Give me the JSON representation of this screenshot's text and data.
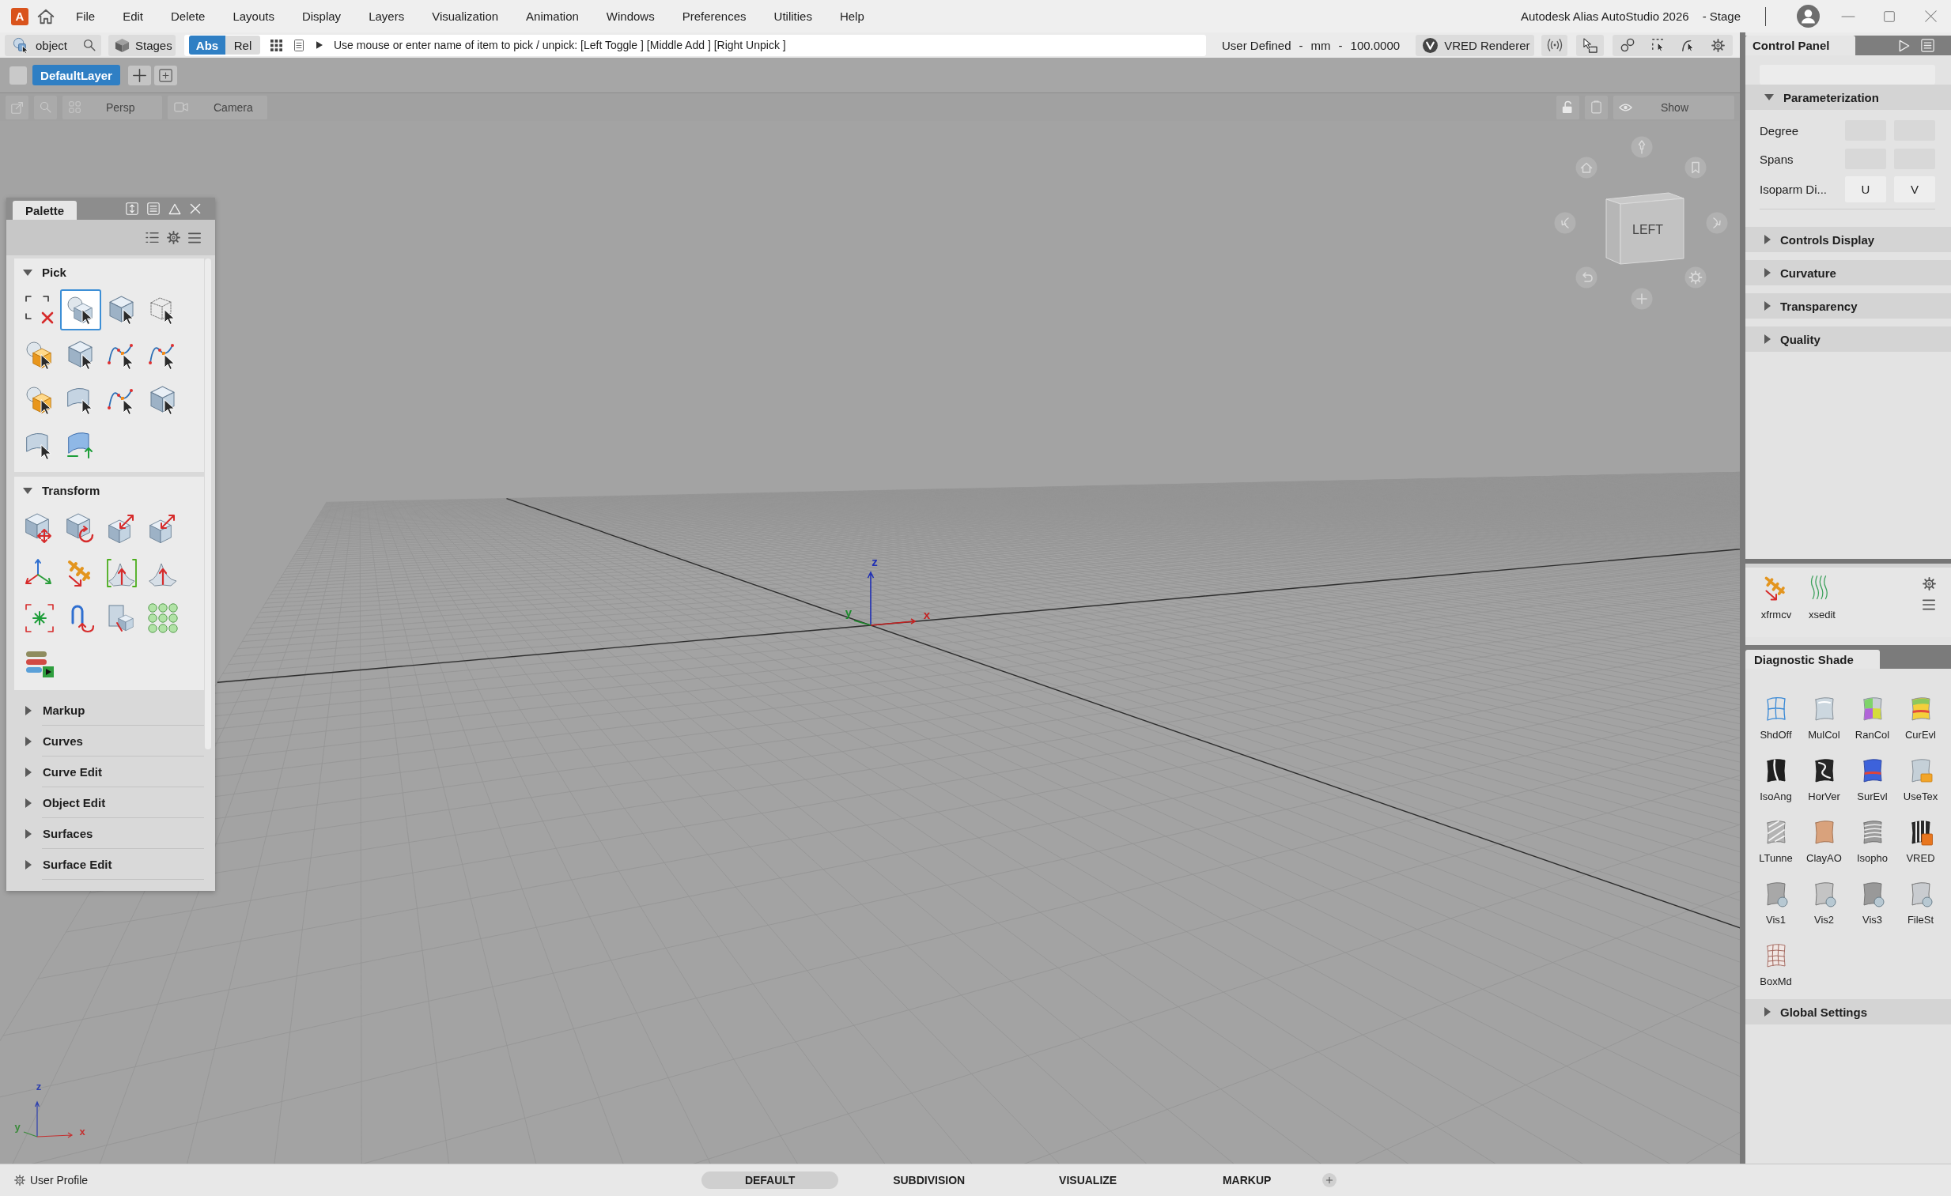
{
  "menu_bar": {
    "logo_letter": "A",
    "items": [
      "File",
      "Edit",
      "Delete",
      "Layouts",
      "Display",
      "Layers",
      "Visualization",
      "Animation",
      "Windows",
      "Preferences",
      "Utilities",
      "Help"
    ],
    "title": "Autodesk Alias AutoStudio 2026",
    "workspace": "- Stage"
  },
  "toolbar": {
    "pick_mode": "object",
    "stages": "Stages",
    "coordinate_modes": [
      {
        "label": "Abs",
        "selected": true
      },
      {
        "label": "Rel",
        "selected": false
      }
    ],
    "prompt": "Use mouse or enter name of item to pick / unpick: [Left Toggle ] [Middle Add ] [Right Unpick ]",
    "construction_plane": [
      "User Defined",
      "-",
      "mm",
      "-",
      "100.0000"
    ],
    "renderer": "VRED Renderer"
  },
  "layer_bar": {
    "layers": [
      {
        "name": "DefaultLayer",
        "selected": true
      }
    ]
  },
  "viewport_toolbar": {
    "view": "Persp",
    "camera": "Camera",
    "show": "Show"
  },
  "viewport": {
    "axis_labels": [
      {
        "text": "z",
        "color": "#1f2fb4"
      },
      {
        "text": "y",
        "color": "#1d8a2c"
      },
      {
        "text": "x",
        "color": "#c42222"
      }
    ],
    "corner_axis_labels": [
      {
        "text": "z",
        "color": "#2c3eae"
      },
      {
        "text": "y",
        "color": "#3a8a3a"
      },
      {
        "text": "x",
        "color": "#c43030"
      }
    ],
    "view_cube_face": "LEFT"
  },
  "palette": {
    "title": "Palette",
    "sections": [
      {
        "title": "Pick",
        "expanded": true,
        "tools": [
          {
            "selected": false
          },
          {
            "selected": true
          },
          {
            "selected": false
          },
          {
            "selected": false
          },
          {
            "selected": false
          },
          {
            "selected": false
          },
          {
            "selected": false
          },
          {
            "selected": false
          },
          {
            "selected": false
          },
          {
            "selected": false
          },
          {
            "selected": false
          },
          {
            "selected": false
          },
          {
            "selected": false
          },
          {
            "selected": false
          }
        ]
      },
      {
        "title": "Transform",
        "expanded": true,
        "tools": [
          {
            "selected": false
          },
          {
            "selected": false
          },
          {
            "selected": false
          },
          {
            "selected": false
          },
          {
            "selected": false
          },
          {
            "selected": false
          },
          {
            "selected": false
          },
          {
            "selected": false
          },
          {
            "selected": false
          },
          {
            "selected": false
          },
          {
            "selected": false
          },
          {
            "selected": false
          },
          {
            "selected": false
          }
        ]
      },
      {
        "title": "Markup",
        "expanded": false
      },
      {
        "title": "Curves",
        "expanded": false
      },
      {
        "title": "Curve Edit",
        "expanded": false
      },
      {
        "title": "Object Edit",
        "expanded": false
      },
      {
        "title": "Surfaces",
        "expanded": false
      },
      {
        "title": "Surface Edit",
        "expanded": false
      }
    ]
  },
  "control_panel": {
    "title": "Control Panel",
    "sections": [
      {
        "title": "Parameterization",
        "expanded": true,
        "rows": [
          {
            "kind": "fields",
            "label": "Degree"
          },
          {
            "kind": "fields",
            "label": "Spans"
          },
          {
            "kind": "buttons",
            "label": "Isoparm Di...",
            "buttons": [
              "U",
              "V"
            ]
          }
        ]
      },
      {
        "title": "Controls Display",
        "expanded": false
      },
      {
        "title": "Curvature",
        "expanded": false
      },
      {
        "title": "Transparency",
        "expanded": false
      },
      {
        "title": "Quality",
        "expanded": false
      }
    ]
  },
  "shelf": {
    "items": [
      "xfrmcv",
      "xsedit"
    ]
  },
  "diagnostic_shade": {
    "title": "Diagnostic Shade",
    "items": [
      "ShdOff",
      "MulCol",
      "RanCol",
      "CurEvl",
      "IsoAng",
      "HorVer",
      "SurEvl",
      "UseTex",
      "LTunne",
      "ClayAO",
      "Isopho",
      "VRED",
      "Vis1",
      "Vis2",
      "Vis3",
      "FileSt",
      "BoxMd"
    ],
    "sections": [
      {
        "title": "Global Settings",
        "expanded": false
      }
    ]
  },
  "status_bar": {
    "profile": "User Profile",
    "tabs": [
      {
        "label": "DEFAULT",
        "selected": true
      },
      {
        "label": "SUBDIVISION",
        "selected": false
      },
      {
        "label": "VISUALIZE",
        "selected": false
      },
      {
        "label": "MARKUP",
        "selected": false
      }
    ]
  }
}
